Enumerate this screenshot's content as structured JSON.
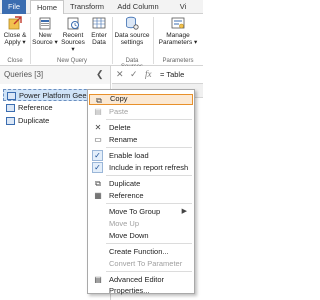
{
  "tabs": [
    "File",
    "Home",
    "Transform",
    "Add Column",
    "Vi"
  ],
  "ribbon": {
    "buttons": [
      {
        "label1": "Close &",
        "label2": "Apply ▾"
      },
      {
        "label1": "New",
        "label2": "Source ▾"
      },
      {
        "label1": "Recent",
        "label2": "Sources ▾"
      },
      {
        "label1": "Enter",
        "label2": "Data"
      },
      {
        "label1": "Data source",
        "label2": "settings"
      },
      {
        "label1": "Manage",
        "label2": "Parameters ▾"
      }
    ],
    "groups": [
      "Close",
      "New Query",
      "Data Sources",
      "Parameters"
    ]
  },
  "queries_pane": {
    "title": "Queries [3]",
    "collapse_glyph": "❮",
    "items": [
      "Power Platform Geeks",
      "Reference",
      "Duplicate"
    ]
  },
  "formula_bar": {
    "x": "✕",
    "check": "✓",
    "fx": "fx",
    "value": "= Table"
  },
  "context_menu": {
    "items": [
      {
        "label": "Copy",
        "icon": "copy-icon"
      },
      {
        "label": "Paste",
        "icon": "paste-icon"
      },
      {
        "label": "Delete",
        "icon": "delete-icon"
      },
      {
        "label": "Rename",
        "icon": "rename-icon"
      },
      {
        "label": "Enable load",
        "checked": true
      },
      {
        "label": "Include in report refresh",
        "checked": true
      },
      {
        "label": "Duplicate",
        "icon": "duplicate-icon"
      },
      {
        "label": "Reference",
        "icon": "reference-icon"
      },
      {
        "label": "Move To Group"
      },
      {
        "label": "Move Up"
      },
      {
        "label": "Move Down"
      },
      {
        "label": "Create Function..."
      },
      {
        "label": "Convert To Parameter"
      },
      {
        "label": "Advanced Editor",
        "icon": "advanced-editor-icon"
      },
      {
        "label": "Properties..."
      }
    ],
    "submenu_arrow": "▶"
  },
  "colors": {
    "accent": "#3b6db0",
    "highlight_border": "#e8902a",
    "selection": "#cfe3f7"
  }
}
